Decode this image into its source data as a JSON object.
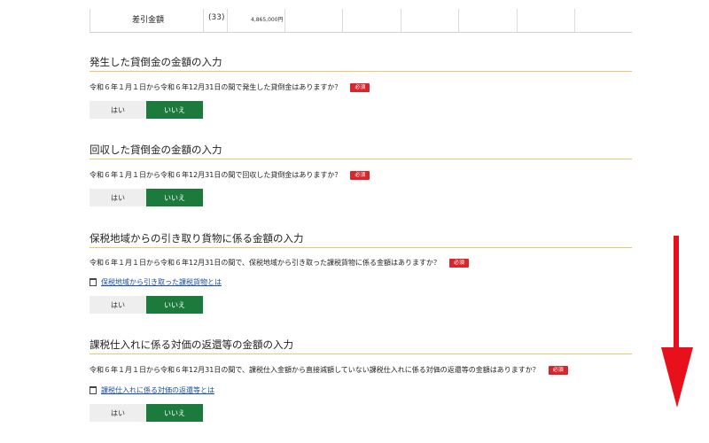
{
  "top_row": {
    "label": "差引金額",
    "number": "(33)",
    "amount": "4,865,000円"
  },
  "sections": [
    {
      "title": "発生した貸倒金の金額の入力",
      "question": "令和６年１月１日から令和６年12月31日の間で発生した貸倒金はありますか？",
      "required": "必須",
      "link": "",
      "yes": "はい",
      "no": "いいえ"
    },
    {
      "title": "回収した貸倒金の金額の入力",
      "question": "令和６年１月１日から令和６年12月31日の間で回収した貸倒金はありますか？",
      "required": "必須",
      "link": "",
      "yes": "はい",
      "no": "いいえ"
    },
    {
      "title": "保税地域からの引き取り貨物に係る金額の入力",
      "question": "令和６年１月１日から令和６年12月31日の間で、保税地域から引き取った課税貨物に係る金額はありますか？",
      "required": "必須",
      "link": "保税地域から引き取った課税貨物とは",
      "yes": "はい",
      "no": "いいえ"
    },
    {
      "title": "課税仕入れに係る対価の返還等の金額の入力",
      "question": "令和６年１月１日から令和６年12月31日の間で、課税仕入金額から直接減額していない課税仕入れに係る対価の返還等の金額はありますか？",
      "required": "必須",
      "link": "課税仕入れに係る対価の返還等とは",
      "yes": "はい",
      "no": "いいえ"
    }
  ],
  "colors": {
    "required_badge": "#d9262c",
    "selected_no": "#1d7a3d",
    "section_rule": "#f0c66a",
    "link": "#1a4fa3",
    "arrow": "#e8101a"
  },
  "icons": {
    "link_icon": "window-icon",
    "scroll_indicator": "arrow-down-icon"
  }
}
